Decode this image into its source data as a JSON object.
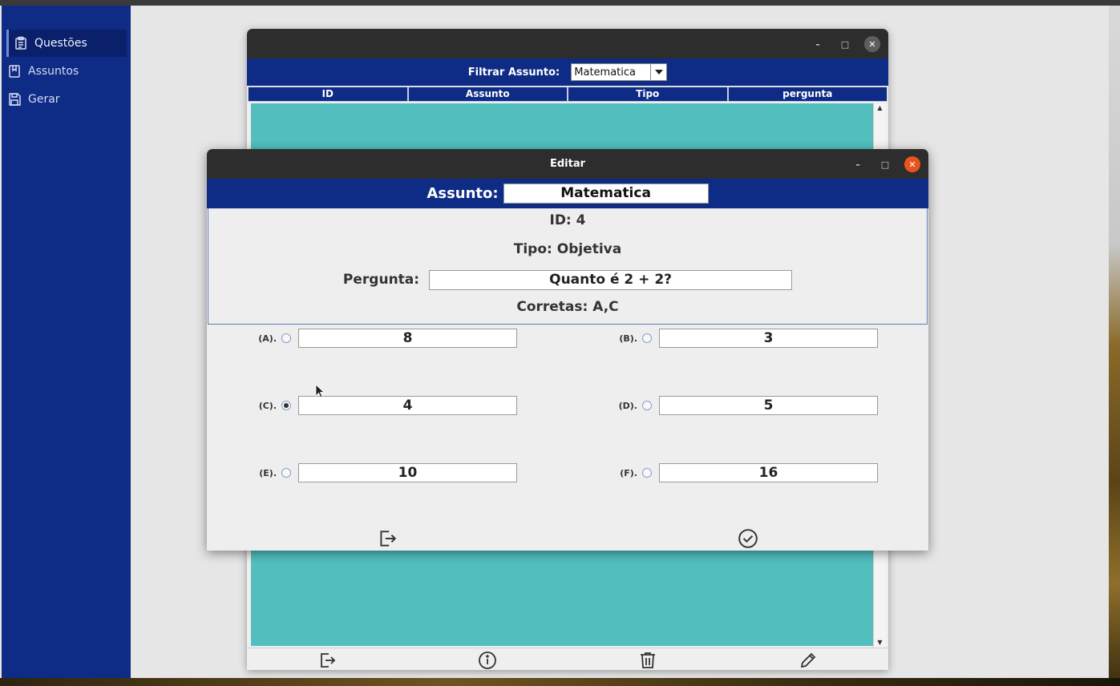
{
  "sidebar": {
    "items": [
      {
        "label": "Questões",
        "icon": "clipboard-icon",
        "active": true
      },
      {
        "label": "Assuntos",
        "icon": "book-icon",
        "active": false
      },
      {
        "label": "Gerar",
        "icon": "save-icon",
        "active": false
      }
    ]
  },
  "list_window": {
    "filter_label": "Filtrar Assunto:",
    "filter_value": "Matematica",
    "columns": [
      "ID",
      "Assunto",
      "Tipo",
      "pergunta"
    ],
    "toolbar_icons": [
      "exit-icon",
      "info-icon",
      "trash-icon",
      "pencil-icon"
    ]
  },
  "edit_dialog": {
    "title": "Editar",
    "assunto_label": "Assunto:",
    "assunto_value": "Matematica",
    "id_text": "ID: 4",
    "tipo_text": "Tipo: Objetiva",
    "pergunta_label": "Pergunta:",
    "pergunta_value": "Quanto é 2 + 2?",
    "corretas_text": "Corretas: A,C",
    "options": [
      {
        "label": "(A).",
        "value": "8",
        "selected": false
      },
      {
        "label": "(B).",
        "value": "3",
        "selected": false
      },
      {
        "label": "(C).",
        "value": "4",
        "selected": true
      },
      {
        "label": "(D).",
        "value": "5",
        "selected": false
      },
      {
        "label": "(E).",
        "value": "10",
        "selected": false
      },
      {
        "label": "(F).",
        "value": "16",
        "selected": false
      }
    ],
    "footer_icons": [
      "exit-icon",
      "confirm-check-icon"
    ]
  },
  "colors": {
    "sidebar_bg": "#0e2b86",
    "header_bg": "#0e2b86",
    "table_bg": "#52bfbe",
    "titlebar_bg": "#2d2d2d",
    "close_red": "#e9541c"
  }
}
